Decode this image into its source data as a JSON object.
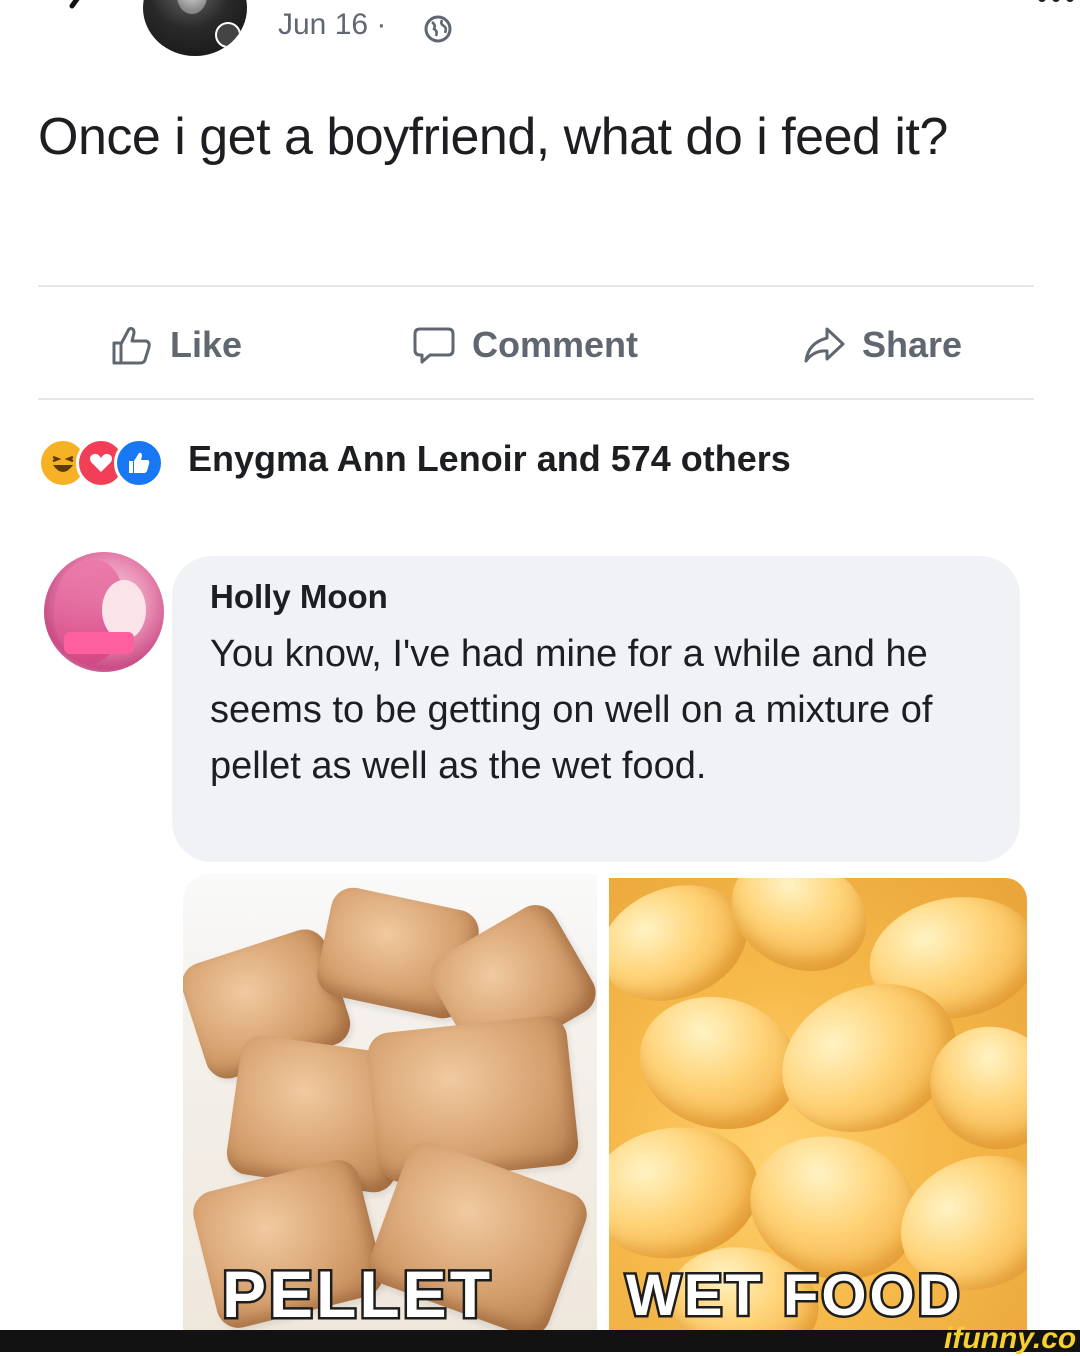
{
  "header": {
    "date": "Jun 16 ·",
    "privacy_icon": "globe-icon",
    "back_icon": "chevron-left-icon",
    "more_icon": "more-icon"
  },
  "post": {
    "text": "Once i get a boyfriend, what do i feed it?"
  },
  "actions": {
    "like": "Like",
    "comment": "Comment",
    "share": "Share"
  },
  "reactions": {
    "icons": [
      "haha-reaction-icon",
      "love-reaction-icon",
      "like-reaction-icon"
    ],
    "summary": "Enygma Ann Lenoir and 574 others"
  },
  "comment": {
    "author": "Holly Moon",
    "text": "You know, I've had mine for a while and he seems to be getting on well on a mixture of pellet as well as the wet food."
  },
  "images": {
    "left_caption": "PELLET",
    "right_caption": "WET FOOD"
  },
  "watermark": "ifunny.co",
  "colors": {
    "text_primary": "#1c1e21",
    "text_secondary": "#606770",
    "bubble": "#f0f2f5",
    "divider": "#e4e6eb",
    "watermark": "#f6d02e"
  }
}
